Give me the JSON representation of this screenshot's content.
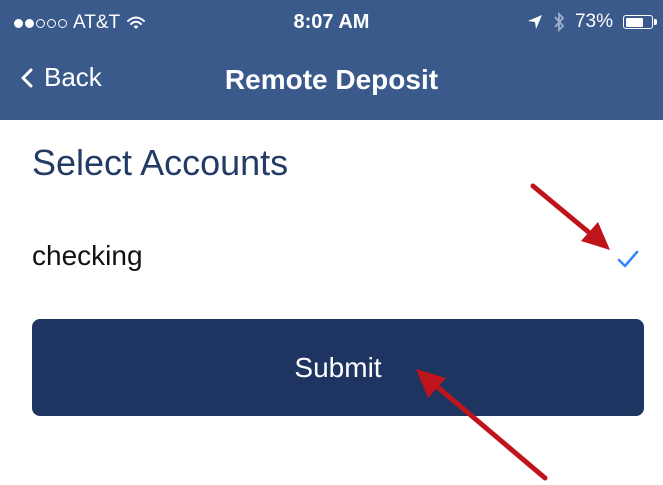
{
  "status_bar": {
    "carrier": "AT&T",
    "time": "8:07 AM",
    "battery_percent": "73%",
    "battery_level": 0.73,
    "signal_filled": 2,
    "signal_total": 5
  },
  "nav": {
    "back_label": "Back",
    "title": "Remote Deposit"
  },
  "content": {
    "section_title": "Select Accounts",
    "accounts": [
      {
        "label": "checking",
        "selected": true
      }
    ],
    "submit_label": "Submit"
  },
  "colors": {
    "nav_background": "#3a5a8c",
    "submit_background": "#1e3461",
    "section_title": "#243b66",
    "checkmark": "#2f8af5",
    "annotation_arrow": "#c0141c"
  },
  "icons": [
    "back-chevron-icon",
    "wifi-icon",
    "location-arrow-icon",
    "bluetooth-icon",
    "battery-icon",
    "checkmark-icon"
  ]
}
